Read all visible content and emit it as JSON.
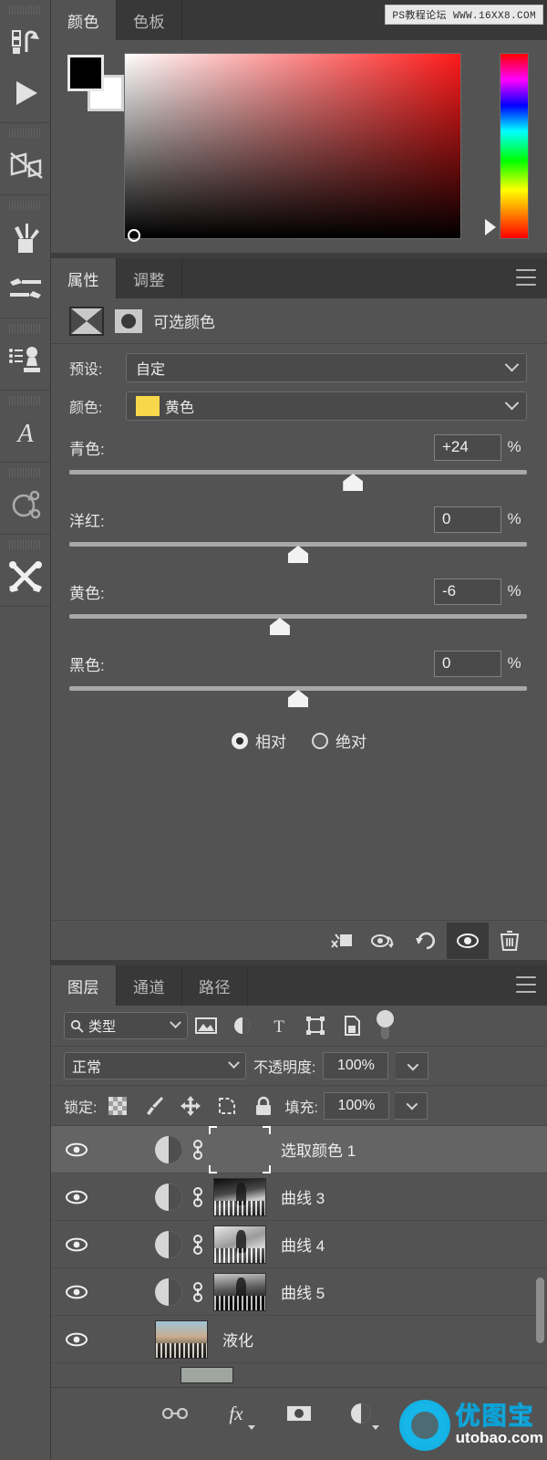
{
  "watermarks": {
    "top": "PS教程论坛 WWW.16XX8.COM",
    "bottom_main": "优图宝",
    "bottom_sub": "utobao.com"
  },
  "toolbar": {
    "tools": [
      {
        "name": "history-actions-tool",
        "label": "历史记录"
      },
      {
        "name": "play-action-tool",
        "label": "播放"
      },
      {
        "name": "slice-tool",
        "label": "切片工具"
      },
      {
        "name": "brush-holder-tool",
        "label": "画笔工具组"
      },
      {
        "name": "paint-tools",
        "label": "绘画工具"
      },
      {
        "name": "clone-stamp-tool",
        "label": "仿制图章"
      },
      {
        "name": "type-tool",
        "label": "文字工具"
      },
      {
        "name": "3d-tool",
        "label": "3D 工具"
      },
      {
        "name": "edit-toolbar-tool",
        "label": "编辑工具栏"
      }
    ]
  },
  "color_panel": {
    "tabs": [
      {
        "label": "颜色",
        "active": true
      },
      {
        "label": "色板",
        "active": false
      }
    ],
    "foreground": "#000000",
    "background": "#ffffff",
    "hue_marker_percent": 92
  },
  "properties_panel": {
    "tabs": [
      {
        "label": "属性",
        "active": true
      },
      {
        "label": "调整",
        "active": false
      }
    ],
    "adjustment_title": "可选颜色",
    "preset": {
      "label": "预设:",
      "value": "自定"
    },
    "color": {
      "label": "颜色:",
      "value": "黄色",
      "chip": "#f7d84b"
    },
    "sliders": [
      {
        "label": "青色:",
        "value": "+24",
        "unit": "%",
        "pos": 62
      },
      {
        "label": "洋红:",
        "value": "0",
        "unit": "%",
        "pos": 50
      },
      {
        "label": "黄色:",
        "value": "-6",
        "unit": "%",
        "pos": 46
      },
      {
        "label": "黑色:",
        "value": "0",
        "unit": "%",
        "pos": 50
      }
    ],
    "method": [
      {
        "label": "相对",
        "selected": true
      },
      {
        "label": "绝对",
        "selected": false
      }
    ],
    "footer_buttons": [
      {
        "name": "clip-to-layer-button",
        "active": false
      },
      {
        "name": "preview-toggle-button",
        "active": false
      },
      {
        "name": "reset-button",
        "active": false
      },
      {
        "name": "visibility-button",
        "active": true
      },
      {
        "name": "delete-button",
        "active": false
      }
    ]
  },
  "layers_panel": {
    "tabs": [
      {
        "label": "图层",
        "active": true
      },
      {
        "label": "通道",
        "active": false
      },
      {
        "label": "路径",
        "active": false
      }
    ],
    "filter": {
      "type_label": "类型",
      "icons": [
        "pixel-filter-icon",
        "adjustment-filter-icon",
        "type-filter-icon",
        "shape-filter-icon",
        "smartobject-filter-icon"
      ],
      "toggle_on": true
    },
    "blend": {
      "mode": "正常",
      "opacity_label": "不透明度:",
      "opacity_value": "100%"
    },
    "lock": {
      "label": "锁定:",
      "icons": [
        "lock-transparency-icon",
        "lock-image-icon",
        "lock-position-icon",
        "lock-artboard-icon",
        "lock-all-icon"
      ],
      "fill_label": "填充:",
      "fill_value": "100%"
    },
    "layers": [
      {
        "name": "选取颜色 1",
        "type": "adjustment",
        "thumb": "white-mask",
        "selected": true,
        "visible": true,
        "linked": true
      },
      {
        "name": "曲线 3",
        "type": "adjustment",
        "thumb": "photo-a",
        "selected": false,
        "visible": true,
        "linked": true
      },
      {
        "name": "曲线 4",
        "type": "adjustment",
        "thumb": "photo-b",
        "selected": false,
        "visible": true,
        "linked": true
      },
      {
        "name": "曲线 5",
        "type": "adjustment",
        "thumb": "photo-c",
        "selected": false,
        "visible": true,
        "linked": true
      },
      {
        "name": "液化",
        "type": "pixel",
        "thumb": "photo-color",
        "selected": false,
        "visible": true,
        "linked": false
      }
    ],
    "footer_buttons": [
      {
        "name": "link-layers-button"
      },
      {
        "name": "layer-style-button"
      },
      {
        "name": "add-mask-button"
      },
      {
        "name": "new-adjustment-layer-button"
      },
      {
        "name": "new-group-button"
      }
    ]
  }
}
